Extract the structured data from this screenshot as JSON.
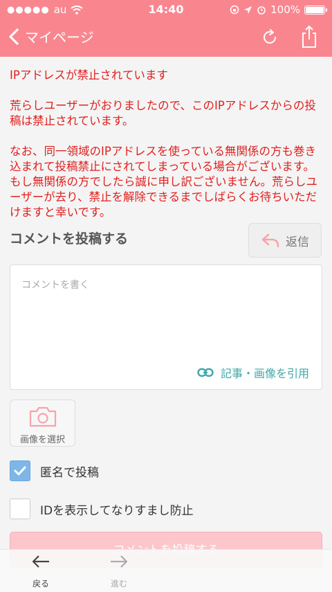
{
  "status": {
    "carrier": "au",
    "time": "14:40",
    "battery": "100%"
  },
  "header": {
    "back_label": "マイページ",
    "background": "#f9868f"
  },
  "warning": {
    "title": "IPアドレスが禁止されています",
    "paragraph1": "荒らしユーザーがおりましたので、このIPアドレスからの投稿は禁止されています。",
    "paragraph2": "なお、同一領域のIPアドレスを使っている無関係の方も巻き込まれて投稿禁止にされてしまっている場合がございます。もし無関係の方でしたら誠に申し訳ございません。荒らしユーザーが去り、禁止を解除できるまでしばらくお待ちいただけますと幸いです。",
    "color": "#e0201e"
  },
  "comment": {
    "section_title": "コメントを投稿する",
    "reply_label": "返信",
    "placeholder": "コメントを書く",
    "value": "",
    "quote_label": "記事・画像を引用",
    "image_label": "画像を選択",
    "anonymous_label": "匿名で投稿",
    "anonymous_checked": true,
    "show_id_label": "IDを表示してなりすまし防止",
    "show_id_checked": false,
    "submit_label": "コメントを投稿する"
  },
  "toolbar": {
    "back_label": "戻る",
    "forward_label": "進む"
  },
  "icons": {
    "back": "chevron-left-icon",
    "reload": "reload-icon",
    "share": "share-icon",
    "reply": "reply-icon",
    "link": "link-icon",
    "camera": "camera-icon",
    "check": "checkmark-icon"
  }
}
